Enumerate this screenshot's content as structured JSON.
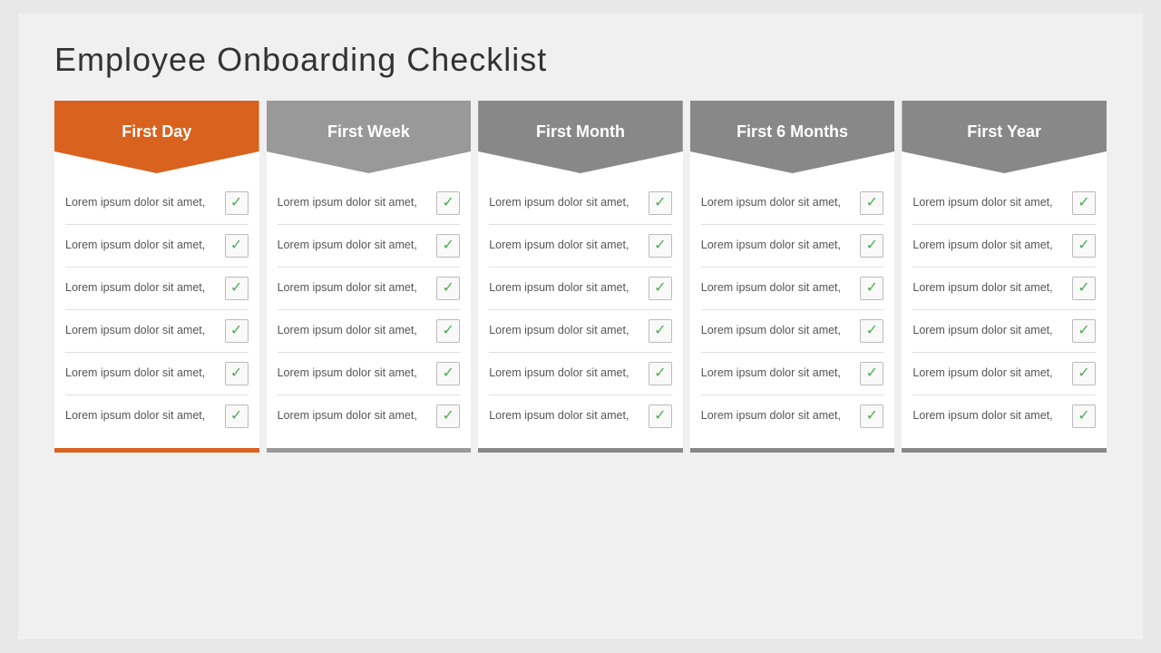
{
  "title": "Employee  Onboarding Checklist",
  "columns": [
    {
      "id": "first-day",
      "header": "First Day",
      "colorClass": "orange",
      "items": [
        {
          "text": "Lorem ipsum dolor sit amet,"
        },
        {
          "text": "Lorem ipsum dolor sit amet,"
        },
        {
          "text": "Lorem ipsum dolor sit amet,"
        },
        {
          "text": "Lorem ipsum dolor sit amet,"
        },
        {
          "text": "Lorem ipsum dolor sit amet,"
        },
        {
          "text": "Lorem ipsum dolor sit amet,"
        }
      ]
    },
    {
      "id": "first-week",
      "header": "First Week",
      "colorClass": "gray1",
      "items": [
        {
          "text": "Lorem ipsum dolor sit amet,"
        },
        {
          "text": "Lorem ipsum dolor sit amet,"
        },
        {
          "text": "Lorem ipsum dolor sit amet,"
        },
        {
          "text": "Lorem ipsum dolor sit amet,"
        },
        {
          "text": "Lorem ipsum dolor sit amet,"
        },
        {
          "text": "Lorem ipsum dolor sit amet,"
        }
      ]
    },
    {
      "id": "first-month",
      "header": "First Month",
      "colorClass": "gray2",
      "items": [
        {
          "text": "Lorem ipsum dolor sit amet,"
        },
        {
          "text": "Lorem ipsum dolor sit amet,"
        },
        {
          "text": "Lorem ipsum dolor sit amet,"
        },
        {
          "text": "Lorem ipsum dolor sit amet,"
        },
        {
          "text": "Lorem ipsum dolor sit amet,"
        },
        {
          "text": "Lorem ipsum dolor sit amet,"
        }
      ]
    },
    {
      "id": "first-6-months",
      "header": "First 6 Months",
      "colorClass": "gray3",
      "items": [
        {
          "text": "Lorem ipsum dolor sit amet,"
        },
        {
          "text": "Lorem ipsum dolor sit amet,"
        },
        {
          "text": "Lorem ipsum dolor sit amet,"
        },
        {
          "text": "Lorem ipsum dolor sit amet,"
        },
        {
          "text": "Lorem ipsum dolor sit amet,"
        },
        {
          "text": "Lorem ipsum dolor sit amet,"
        }
      ]
    },
    {
      "id": "first-year",
      "header": "First Year",
      "colorClass": "gray4",
      "items": [
        {
          "text": "Lorem ipsum dolor sit amet,"
        },
        {
          "text": "Lorem ipsum dolor sit amet,"
        },
        {
          "text": "Lorem ipsum dolor sit amet,"
        },
        {
          "text": "Lorem ipsum dolor sit amet,"
        },
        {
          "text": "Lorem ipsum dolor sit amet,"
        },
        {
          "text": "Lorem ipsum dolor sit amet,"
        }
      ]
    }
  ],
  "checkmark": "✓"
}
